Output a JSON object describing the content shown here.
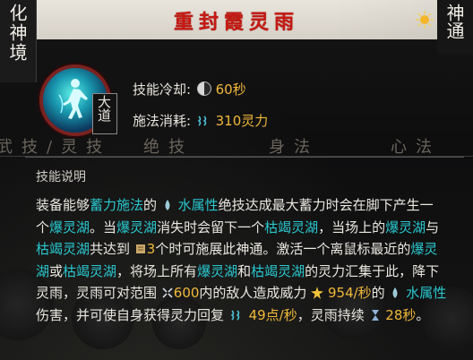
{
  "window": {
    "title": "重封霞灵雨"
  },
  "left_badge": {
    "text": "化神境"
  },
  "right_badge": {
    "text": "神通"
  },
  "skill": {
    "icon": "spirit-figure-icon",
    "tag": "大道",
    "cooldown_label": "技能冷却:",
    "cooldown_value": "60秒",
    "cost_label": "施法消耗:",
    "cost_value": "310灵力"
  },
  "tabs": [
    "武技/灵技",
    "绝技",
    "身法",
    "心法"
  ],
  "section_title": "技能说明",
  "description": {
    "l1a": "装备能够",
    "l1b": "蓄力施法",
    "l1c": "的 ",
    "l1d": "水属性",
    "l1e": "绝技达成最大蓄力时会在脚下产生一",
    "l2a": "个",
    "l2b": "爆灵湖",
    "l2c": "。当",
    "l2d": "爆灵湖",
    "l2e": "消失时会留下一个",
    "l2f": "枯竭灵湖",
    "l2g": "，当场上的",
    "l2h": "爆灵湖",
    "l2i": "与",
    "l3a": "枯竭灵湖",
    "l3b": "共达到 ",
    "l3c": "3",
    "l3d": "个时可施展此神通。激活一个离鼠标最近的",
    "l3e": "爆灵",
    "l4a": "湖",
    "l4b": "或",
    "l4c": "枯竭灵湖",
    "l4d": "，将场上所有",
    "l4e": "爆灵湖",
    "l4f": "和",
    "l4g": "枯竭灵湖",
    "l4h": "的灵力汇集于此，降下",
    "l5a": "灵雨，灵雨可对范围 ",
    "l5b": "600",
    "l5c": "内的敌人造成威力 ",
    "l5d": "954/秒",
    "l5e": "的 ",
    "l5f": "水属性",
    "l6a": "伤害，并可使自身获得灵力回复 ",
    "l6b": "49点/秒",
    "l6c": "，灵雨持续 ",
    "l6d": "28秒",
    "l6e": "。"
  },
  "colors": {
    "title_red": "#c51a13",
    "highlight_cyan": "#29c8cf",
    "value_gold": "#f0b83a"
  }
}
